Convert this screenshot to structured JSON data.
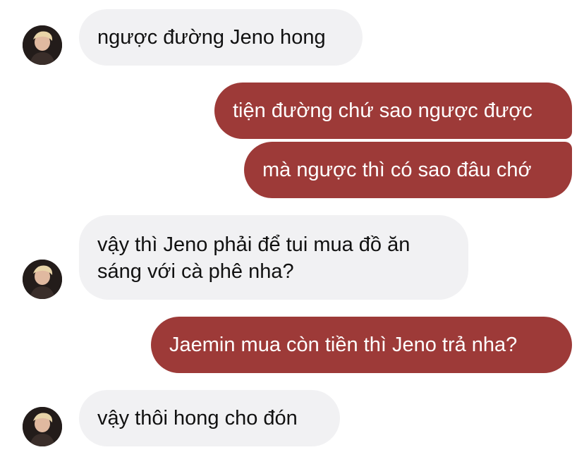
{
  "conversation": {
    "messages": [
      {
        "side": "incoming",
        "text": "ngược đường Jeno hong"
      },
      {
        "side": "outgoing",
        "text": "tiện đường chứ sao ngược được"
      },
      {
        "side": "outgoing",
        "text": "mà ngược thì có sao đâu chớ"
      },
      {
        "side": "incoming",
        "lines": [
          "vậy thì Jeno phải để tui mua đồ ăn",
          "sáng với cà phê nha?"
        ]
      },
      {
        "side": "outgoing",
        "text": "Jaemin mua còn tiền thì Jeno trả nha?"
      },
      {
        "side": "incoming",
        "text": "vậy thôi hong cho đón"
      }
    ]
  },
  "colors": {
    "incoming_bubble": "#f1f1f3",
    "outgoing_bubble": "#9d3a38",
    "incoming_text": "#111111",
    "outgoing_text": "#ffffff"
  },
  "icons": {
    "avatar": "contact-avatar-photo"
  }
}
